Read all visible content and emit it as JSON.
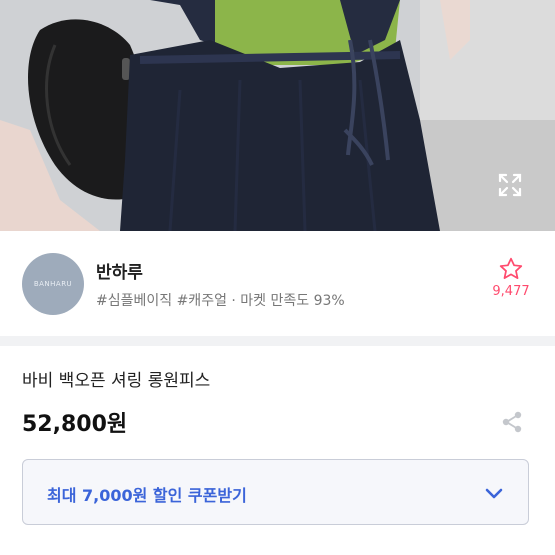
{
  "product_image": {
    "expand_icon": "expand-icon"
  },
  "shop": {
    "avatar_text": "BANHARU",
    "name": "반하루",
    "meta": "#심플베이직 #캐주얼 · 마켓 만족도 93%",
    "favorite_icon": "star-outline-icon",
    "favorite_count": "9,477"
  },
  "product": {
    "title": "바비 백오픈 셔링 롱원피스",
    "price": "52,800원",
    "share_icon": "share-icon"
  },
  "coupon": {
    "label": "최대 7,000원 할인 쿠폰받기",
    "chevron_icon": "chevron-down-icon"
  },
  "colors": {
    "accent_blue": "#3b64d9",
    "favorite_pink": "#ff4b6e",
    "denim": "#1f2535",
    "top_green": "#8cb54a"
  }
}
